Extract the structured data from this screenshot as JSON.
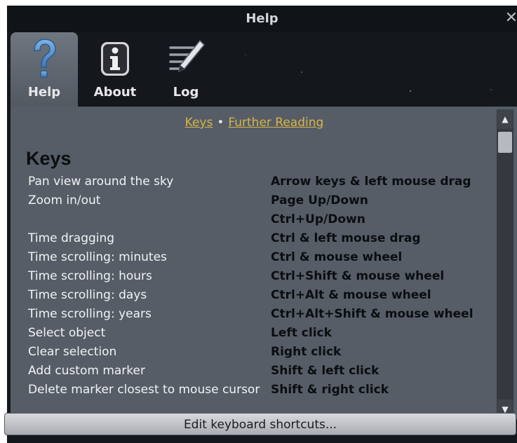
{
  "window": {
    "title": "Help"
  },
  "tabs": [
    {
      "label": "Help",
      "icon": "question-mark-icon",
      "active": true
    },
    {
      "label": "About",
      "icon": "info-icon",
      "active": false
    },
    {
      "label": "Log",
      "icon": "log-pencil-icon",
      "active": false
    }
  ],
  "nav": {
    "keys_link": "Keys",
    "separator": "•",
    "further_link": "Further Reading"
  },
  "section": {
    "heading": "Keys"
  },
  "shortcuts": [
    {
      "action": "Pan view around the sky",
      "keys": [
        "Arrow keys & left mouse drag"
      ]
    },
    {
      "action": "Zoom in/out",
      "keys": [
        "Page Up/Down",
        "Ctrl+Up/Down"
      ]
    },
    {
      "action": "Time dragging",
      "keys": [
        "Ctrl & left mouse drag"
      ]
    },
    {
      "action": "Time scrolling: minutes",
      "keys": [
        "Ctrl & mouse wheel"
      ]
    },
    {
      "action": "Time scrolling: hours",
      "keys": [
        "Ctrl+Shift & mouse wheel"
      ]
    },
    {
      "action": "Time scrolling: days",
      "keys": [
        "Ctrl+Alt & mouse wheel"
      ]
    },
    {
      "action": "Time scrolling: years",
      "keys": [
        "Ctrl+Alt+Shift & mouse wheel"
      ]
    },
    {
      "action": "Select object",
      "keys": [
        "Left click"
      ]
    },
    {
      "action": "Clear selection",
      "keys": [
        "Right click"
      ]
    },
    {
      "action": "Add custom marker",
      "keys": [
        "Shift & left click"
      ]
    },
    {
      "action": "Delete marker closest to mouse cursor",
      "keys": [
        "Shift & right click"
      ]
    }
  ],
  "footer": {
    "button_label": "Edit keyboard shortcuts..."
  },
  "colors": {
    "link": "#d8b44a",
    "panel": "#565d66",
    "window_bg": "#14171c",
    "active_tab": "#6f7680"
  }
}
